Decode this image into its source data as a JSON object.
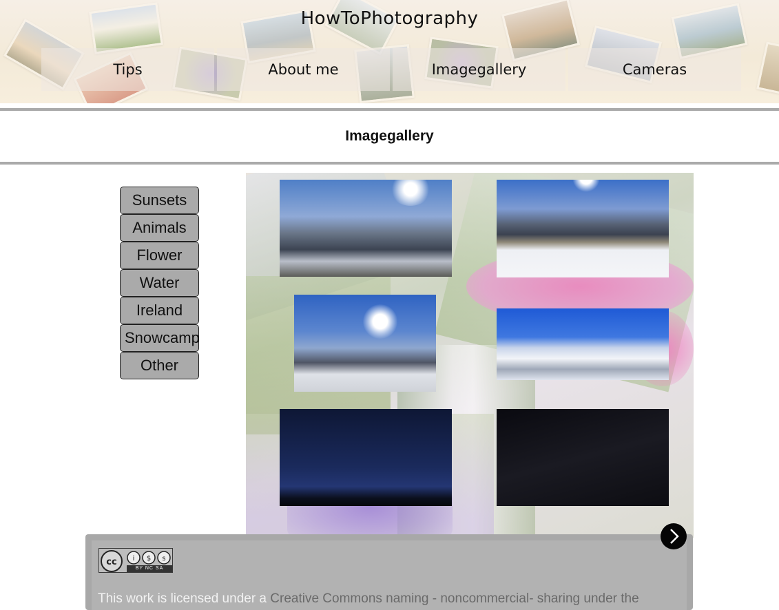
{
  "site": {
    "title": "HowToPhotography"
  },
  "nav": [
    {
      "label": "Tips"
    },
    {
      "label": "About me"
    },
    {
      "label": "Imagegallery"
    },
    {
      "label": "Cameras"
    }
  ],
  "page": {
    "heading": "Imagegallery"
  },
  "categories": [
    {
      "label": "Sunsets"
    },
    {
      "label": "Animals"
    },
    {
      "label": "Flower"
    },
    {
      "label": "Water"
    },
    {
      "label": "Ireland"
    },
    {
      "label": "Snowcamp"
    },
    {
      "label": "Other"
    }
  ],
  "gallery": {
    "thumbnails": [
      {
        "subject": "mountain-valley-sun"
      },
      {
        "subject": "ski-slope-skiers"
      },
      {
        "subject": "sun-over-snowy-slope"
      },
      {
        "subject": "snowy-peaks-blue-sky"
      },
      {
        "subject": "star-trails-blue"
      },
      {
        "subject": "star-trails-black"
      }
    ]
  },
  "license": {
    "badge_text": "BY NC SA",
    "text_prefix": "This work is licensed under a",
    "link_text": "Creative Commons naming - noncommercial- sharing under the"
  },
  "icons": {
    "next": "chevron-right-icon",
    "cc": "cc-icon"
  }
}
